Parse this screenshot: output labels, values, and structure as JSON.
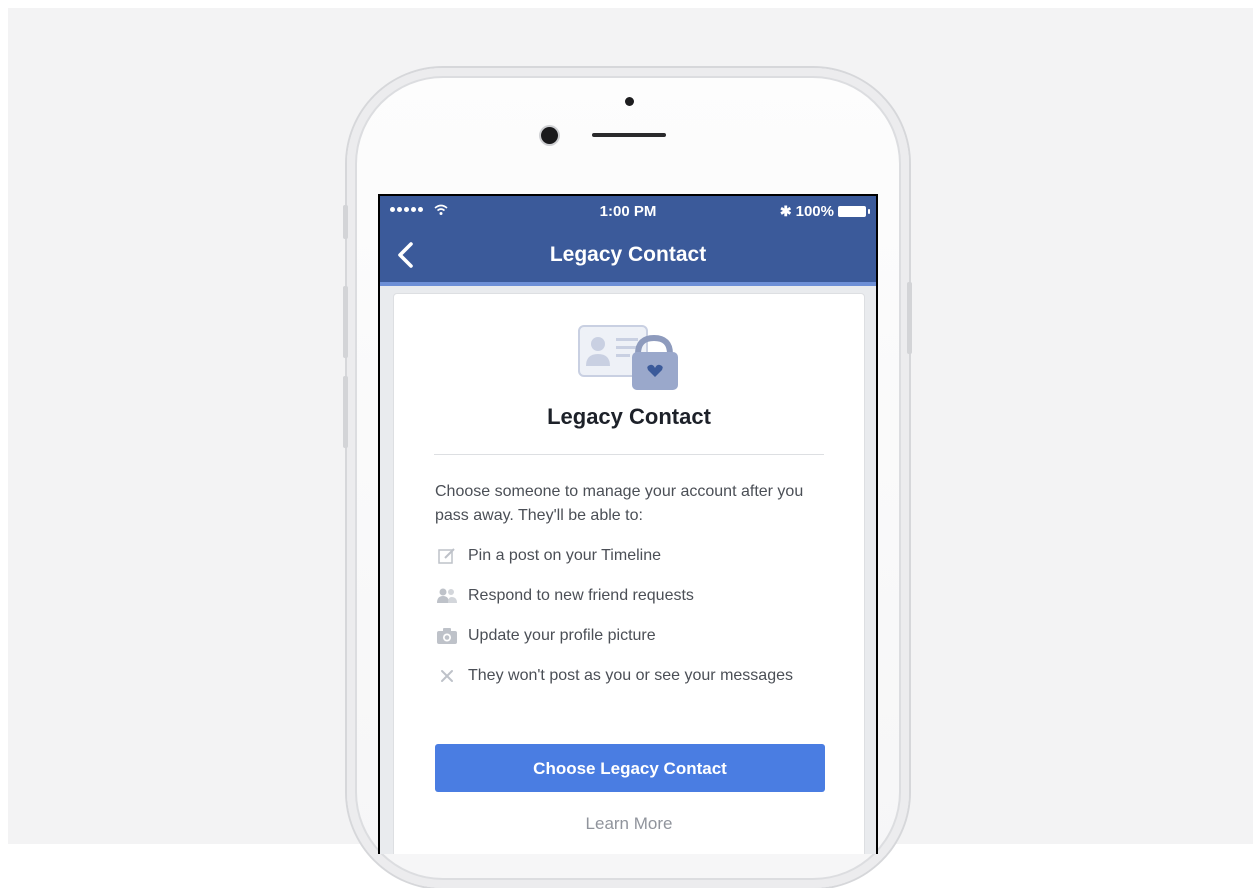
{
  "status_bar": {
    "time": "1:00 PM",
    "battery": "100%",
    "signal_icon": "signal-dots-icon",
    "wifi_icon": "wifi-icon",
    "bluetooth_icon": "bluetooth-icon"
  },
  "nav": {
    "title": "Legacy Contact",
    "back_icon": "chevron-left-icon"
  },
  "card": {
    "hero_icon": "id-card-lock-icon",
    "title": "Legacy Contact",
    "intro": "Choose someone to manage your account after you pass away. They'll be able to:",
    "items": [
      {
        "icon": "edit-pencil-icon",
        "text": "Pin a post on your Timeline"
      },
      {
        "icon": "friends-icon",
        "text": "Respond to new friend requests"
      },
      {
        "icon": "camera-icon",
        "text": "Update your profile picture"
      },
      {
        "icon": "close-x-icon",
        "text": "They won't post as you or see your messages"
      }
    ],
    "cta_label": "Choose Legacy Contact",
    "learn_more_label": "Learn More"
  },
  "colors": {
    "nav_blue": "#3b5a9a",
    "button_blue": "#4a7de2",
    "background": "#f3f3f4"
  }
}
